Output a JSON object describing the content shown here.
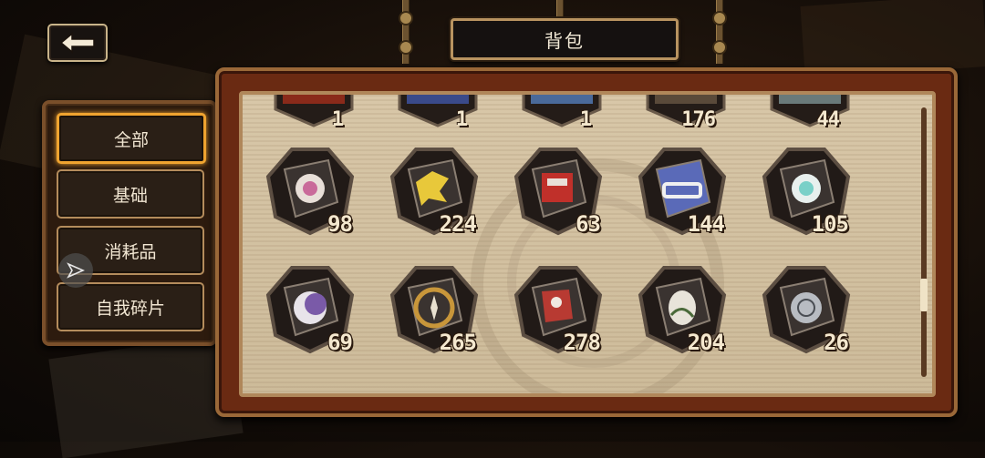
{
  "title": "背包",
  "back_icon": "back-arrow-icon",
  "tabs": [
    {
      "label": "全部",
      "active": true
    },
    {
      "label": "基础",
      "active": false
    },
    {
      "label": "消耗品",
      "active": false
    },
    {
      "label": "自我碎片",
      "active": false
    }
  ],
  "top_row_counts": [
    "1",
    "1",
    "1",
    "176",
    "44"
  ],
  "items": [
    {
      "count": "98",
      "icon": "pink-vortex-emblem-icon",
      "color": "#c96a9a"
    },
    {
      "count": "224",
      "icon": "yellow-bird-emblem-icon",
      "color": "#e8c83a"
    },
    {
      "count": "63",
      "icon": "red-mech-emblem-icon",
      "color": "#c0302a"
    },
    {
      "count": "144",
      "icon": "blue-chain-emblem-icon",
      "color": "#5a6ab8"
    },
    {
      "count": "105",
      "icon": "cyan-swirl-emblem-icon",
      "color": "#7ad0c8"
    },
    {
      "count": "69",
      "icon": "purple-moon-emblem-icon",
      "color": "#7a5aa8"
    },
    {
      "count": "265",
      "icon": "golden-compass-emblem-icon",
      "color": "#c8963a"
    },
    {
      "count": "278",
      "icon": "crimson-figure-emblem-icon",
      "color": "#b83a32"
    },
    {
      "count": "204",
      "icon": "white-egg-emblem-icon",
      "color": "#e8e4da"
    },
    {
      "count": "26",
      "icon": "silver-hive-emblem-icon",
      "color": "#b8bcc2"
    }
  ],
  "floating_icon": "send-arrow-icon"
}
